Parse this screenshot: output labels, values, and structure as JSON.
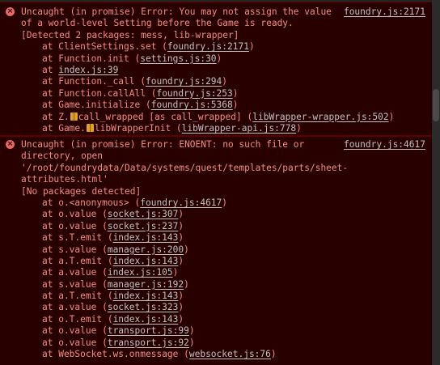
{
  "entries": [
    {
      "icon": "error-icon",
      "source": "foundry.js:2171",
      "message": [
        "Uncaught (in promise) Error: You may not assign the value",
        "of a world-level Setting before the Game is ready.",
        "[Detected 2 packages: mess, lib-wrapper]"
      ],
      "stack": [
        {
          "pre": "at ClientSettings.set (",
          "link": "foundry.js:2171",
          "post": ")"
        },
        {
          "pre": "at Function.init (",
          "link": "settings.js:30",
          "post": ")"
        },
        {
          "pre": "at ",
          "link": "index.js:39",
          "post": ""
        },
        {
          "pre": "at Function._call (",
          "link": "foundry.js:294",
          "post": ")"
        },
        {
          "pre": "at Function.callAll (",
          "link": "foundry.js:253",
          "post": ")"
        },
        {
          "pre": "at Game.initialize (",
          "link": "foundry.js:5368",
          "post": ")"
        },
        {
          "pre": "at Z.",
          "gift": true,
          "pre2": "call_wrapped [as call_wrapped] (",
          "link": "libWrapper-wrapper.js:502",
          "post": ")"
        },
        {
          "pre": "at Game.",
          "gift": true,
          "pre2": "libWrapperInit (",
          "link": "libWrapper-api.js:778",
          "post": ")"
        }
      ]
    },
    {
      "icon": "error-icon",
      "source": "foundry.js:4617",
      "message": [
        "Uncaught (in promise) Error: ENOENT: no such file or",
        "directory, open",
        "'/root/foundrydata/Data/systems/quest/templates/parts/sheet-",
        "attributes.html'",
        "[No packages detected]"
      ],
      "stack": [
        {
          "pre": "at o.<anonymous> (",
          "link": "foundry.js:4617",
          "post": ")"
        },
        {
          "pre": "at o.value (",
          "link": "socket.js:307",
          "post": ")"
        },
        {
          "pre": "at o.value (",
          "link": "socket.js:237",
          "post": ")"
        },
        {
          "pre": "at s.T.emit (",
          "link": "index.js:143",
          "post": ")"
        },
        {
          "pre": "at s.value (",
          "link": "manager.js:200",
          "post": ")"
        },
        {
          "pre": "at a.T.emit (",
          "link": "index.js:143",
          "post": ")"
        },
        {
          "pre": "at a.value (",
          "link": "index.js:105",
          "post": ")"
        },
        {
          "pre": "at s.value (",
          "link": "manager.js:192",
          "post": ")"
        },
        {
          "pre": "at a.T.emit (",
          "link": "index.js:143",
          "post": ")"
        },
        {
          "pre": "at a.value (",
          "link": "socket.js:323",
          "post": ")"
        },
        {
          "pre": "at o.T.emit (",
          "link": "index.js:143",
          "post": ")"
        },
        {
          "pre": "at o.value (",
          "link": "transport.js:99",
          "post": ")"
        },
        {
          "pre": "at o.value (",
          "link": "transport.js:92",
          "post": ")"
        },
        {
          "pre": "at WebSocket.ws.onmessage (",
          "link": "websocket.js:76",
          "post": ")"
        }
      ]
    }
  ],
  "colors": {
    "background": "#242424",
    "error_row": "#290000",
    "error_border": "#5c0000",
    "error_text": "#f28b82",
    "link_text": "#c0c0c0"
  }
}
